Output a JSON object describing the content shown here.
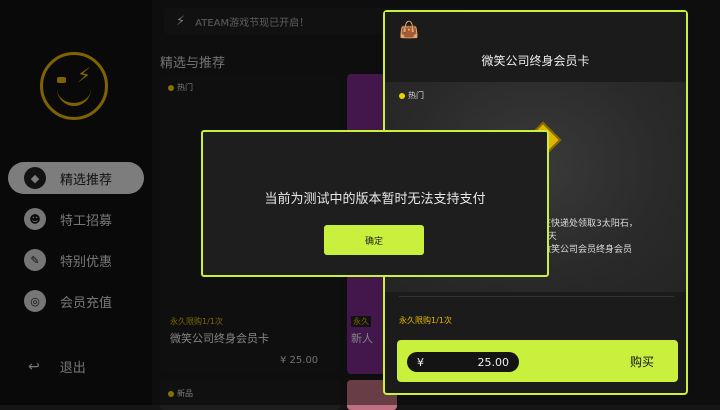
{
  "sidebar": {
    "items": [
      {
        "label": "精选推荐",
        "icon": "diamond-icon",
        "active": true
      },
      {
        "label": "特工招募",
        "icon": "face-icon",
        "active": false
      },
      {
        "label": "特别优惠",
        "icon": "tag-icon",
        "active": false
      },
      {
        "label": "会员充值",
        "icon": "coin-icon",
        "active": false
      }
    ],
    "exit_label": "退出"
  },
  "main": {
    "notice": "ATEAM游戏节现已开启！",
    "section_title": "精选与推荐",
    "cards": [
      {
        "tag": "热门",
        "limit": "永久限购1/1次",
        "name": "微笑公司终身会员卡",
        "price": "¥ 25.00"
      },
      {
        "limit": "永久",
        "name": "新人"
      },
      {
        "tag": "新品"
      }
    ]
  },
  "detail": {
    "title": "微笑公司终身会员卡",
    "tag": "热门",
    "desc_lines": [
      "可在快递处领取3太阳石，",
      "积3天",
      "为微笑公司会员终身会员"
    ],
    "limit": "永久限购1/1次",
    "price": "25.00",
    "currency": "¥",
    "buy_label": "购买"
  },
  "dialog": {
    "message": "当前为测试中的版本暂时无法支持支付",
    "ok_label": "确定"
  },
  "colors": {
    "accent": "#c8f03c",
    "gold": "#e6b800"
  }
}
